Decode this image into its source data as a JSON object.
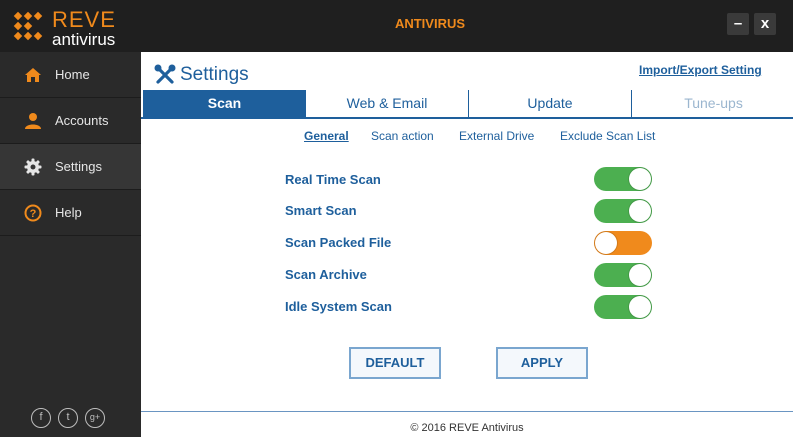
{
  "titlebar": {
    "logo_name": "REVE",
    "logo_sub": "antivirus",
    "title": "ANTIVIRUS",
    "minimize_label": "–",
    "close_label": "x"
  },
  "sidebar": {
    "items": [
      {
        "label": "Home",
        "icon": "home-icon"
      },
      {
        "label": "Accounts",
        "icon": "user-icon"
      },
      {
        "label": "Settings",
        "icon": "gear-icon",
        "active": true
      },
      {
        "label": "Help",
        "icon": "help-icon"
      }
    ],
    "social": [
      "f",
      "t",
      "g+"
    ]
  },
  "main": {
    "title": "Settings",
    "import_export": "Import/Export Setting",
    "tabs": [
      {
        "label": "Scan",
        "active": true
      },
      {
        "label": "Web & Email"
      },
      {
        "label": "Update"
      },
      {
        "label": "Tune-ups"
      }
    ],
    "subtabs": [
      {
        "label": "General",
        "active": true
      },
      {
        "label": "Scan action"
      },
      {
        "label": "External Drive"
      },
      {
        "label": "Exclude Scan List"
      }
    ],
    "options": [
      {
        "label": "Real Time Scan",
        "enabled": true
      },
      {
        "label": "Smart Scan",
        "enabled": true
      },
      {
        "label": "Scan Packed File",
        "enabled": false
      },
      {
        "label": "Scan Archive",
        "enabled": true
      },
      {
        "label": "Idle System Scan",
        "enabled": true
      }
    ],
    "buttons": {
      "default": "DEFAULT",
      "apply": "APPLY"
    },
    "footer": "© 2016 REVE Antivirus"
  },
  "colors": {
    "accent_orange": "#f08a1c",
    "brand_blue": "#1e5f9c",
    "toggle_on": "#4caf50",
    "toggle_off": "#f08a1c",
    "sidebar_bg": "#2a2a2a"
  }
}
